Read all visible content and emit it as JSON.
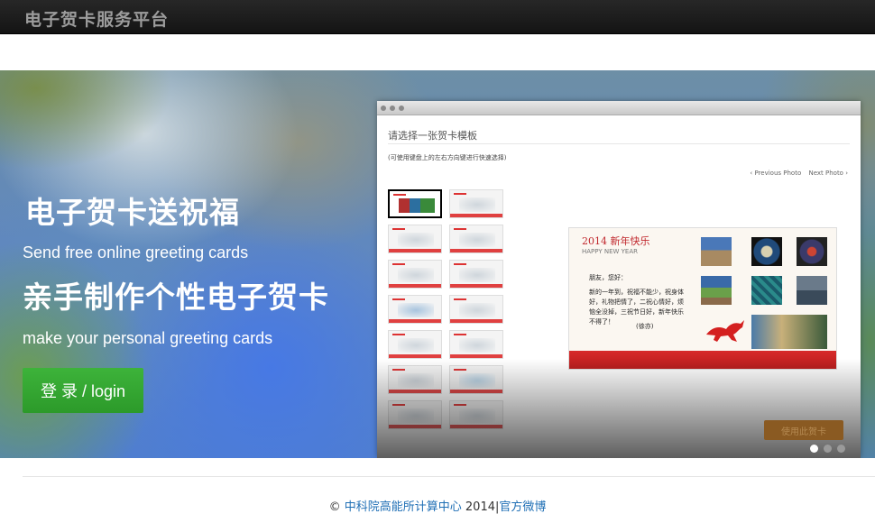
{
  "navbar": {
    "brand": "电子贺卡服务平台"
  },
  "hero": {
    "title": "电子贺卡送祝福",
    "subtitle_en": "Send free online greeting cards",
    "title2": "亲手制作个性电子贺卡",
    "subtitle2_en": "make your personal greeting cards",
    "login_label": "登 录 / login"
  },
  "preview": {
    "heading": "请选择一张贺卡模板",
    "hint": "(可使用键盘上的左右方向键进行快速选择)",
    "prev_label": "‹ Previous Photo",
    "next_label": "Next Photo ›",
    "card_title": "2014 新年快乐",
    "card_subtitle": "HAPPY NEW YEAR",
    "card_greeting": "朋友，您好：",
    "card_body": "新的一年到，祝福不能少，祝身体好，礼物把情了，二祝心情好，烦恼全没掉，三祝节日好，新年快乐不得了！",
    "card_sign": "(徐亦)",
    "use_label": "使用此贺卡",
    "pager_active": 1,
    "pager_total": 3
  },
  "footer": {
    "copyright_symbol": "©",
    "org_link": "中科院高能所计算中心",
    "year_text": "2014|",
    "weibo_link": "官方微博"
  },
  "colors": {
    "navbar_bg": "#1a1a1a",
    "brand_text": "#9c9c9c",
    "login_button": "#37a833",
    "link": "#1f6fb5",
    "card_red": "#c0272d"
  }
}
